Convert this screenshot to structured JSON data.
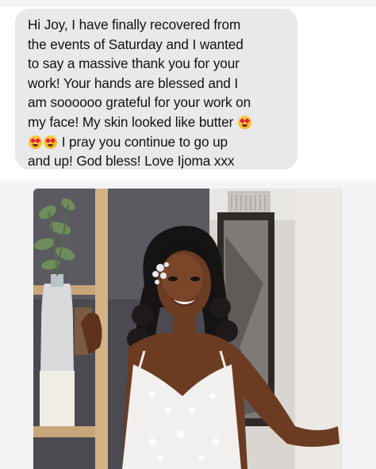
{
  "message": {
    "lines": [
      "Hi Joy, I have finally recovered from",
      "the events of Saturday and I wanted",
      "to say a massive thank you for your",
      "work! Your hands are blessed and I",
      "am soooooo grateful for your work on",
      "my face! My skin looked like butter",
      "I pray you continue to go up",
      "and up! God bless! Love Ijoma xxx"
    ],
    "emoji": "heart-eyes-emoji"
  },
  "photo": {
    "subject": "bride-portrait"
  },
  "colors": {
    "bubble": "#e9e9eb",
    "text": "#111111",
    "background": "#ffffff"
  }
}
